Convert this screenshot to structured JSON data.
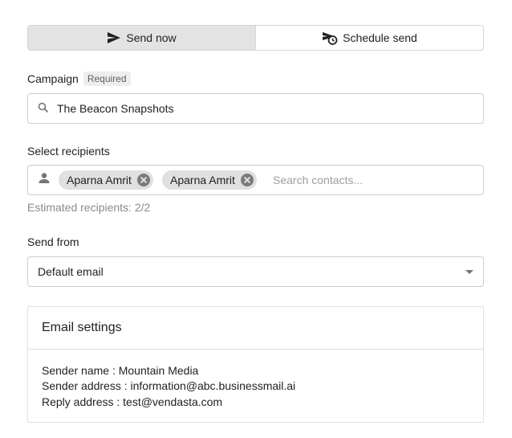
{
  "send_toggle": {
    "send_now_label": "Send now",
    "schedule_send_label": "Schedule send",
    "active": "Send now"
  },
  "campaign": {
    "label": "Campaign",
    "required_badge": "Required",
    "value": "The Beacon Snapshots",
    "icon": "search-icon"
  },
  "recipients": {
    "label": "Select recipients",
    "icon": "person-icon",
    "chips": [
      {
        "label": "Aparna Amrit"
      },
      {
        "label": "Aparna Amrit"
      }
    ],
    "search_placeholder": "Search contacts...",
    "estimated": "Estimated recipients: 2/2"
  },
  "send_from": {
    "label": "Send from",
    "selected": "Default email"
  },
  "email_settings": {
    "title": "Email settings",
    "sender_name": "Sender name : Mountain Media",
    "sender_address": "Sender address : information@abc.businessmail.ai",
    "reply_address": "Reply address : test@vendasta.com"
  },
  "colors": {
    "active_segment_bg": "#e3e3e3",
    "border": "#cccccc",
    "chip_bg": "#e0e0e0",
    "hint_text": "#8a8a8a"
  }
}
